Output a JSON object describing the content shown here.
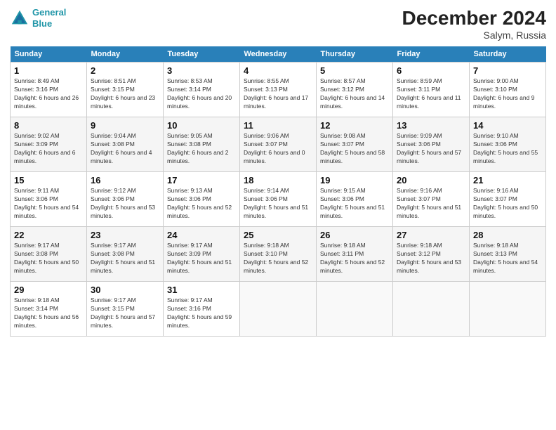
{
  "header": {
    "logo_line1": "General",
    "logo_line2": "Blue",
    "title": "December 2024",
    "subtitle": "Salym, Russia"
  },
  "days_of_week": [
    "Sunday",
    "Monday",
    "Tuesday",
    "Wednesday",
    "Thursday",
    "Friday",
    "Saturday"
  ],
  "weeks": [
    [
      {
        "num": "1",
        "sunrise": "Sunrise: 8:49 AM",
        "sunset": "Sunset: 3:16 PM",
        "daylight": "Daylight: 6 hours and 26 minutes."
      },
      {
        "num": "2",
        "sunrise": "Sunrise: 8:51 AM",
        "sunset": "Sunset: 3:15 PM",
        "daylight": "Daylight: 6 hours and 23 minutes."
      },
      {
        "num": "3",
        "sunrise": "Sunrise: 8:53 AM",
        "sunset": "Sunset: 3:14 PM",
        "daylight": "Daylight: 6 hours and 20 minutes."
      },
      {
        "num": "4",
        "sunrise": "Sunrise: 8:55 AM",
        "sunset": "Sunset: 3:13 PM",
        "daylight": "Daylight: 6 hours and 17 minutes."
      },
      {
        "num": "5",
        "sunrise": "Sunrise: 8:57 AM",
        "sunset": "Sunset: 3:12 PM",
        "daylight": "Daylight: 6 hours and 14 minutes."
      },
      {
        "num": "6",
        "sunrise": "Sunrise: 8:59 AM",
        "sunset": "Sunset: 3:11 PM",
        "daylight": "Daylight: 6 hours and 11 minutes."
      },
      {
        "num": "7",
        "sunrise": "Sunrise: 9:00 AM",
        "sunset": "Sunset: 3:10 PM",
        "daylight": "Daylight: 6 hours and 9 minutes."
      }
    ],
    [
      {
        "num": "8",
        "sunrise": "Sunrise: 9:02 AM",
        "sunset": "Sunset: 3:09 PM",
        "daylight": "Daylight: 6 hours and 6 minutes."
      },
      {
        "num": "9",
        "sunrise": "Sunrise: 9:04 AM",
        "sunset": "Sunset: 3:08 PM",
        "daylight": "Daylight: 6 hours and 4 minutes."
      },
      {
        "num": "10",
        "sunrise": "Sunrise: 9:05 AM",
        "sunset": "Sunset: 3:08 PM",
        "daylight": "Daylight: 6 hours and 2 minutes."
      },
      {
        "num": "11",
        "sunrise": "Sunrise: 9:06 AM",
        "sunset": "Sunset: 3:07 PM",
        "daylight": "Daylight: 6 hours and 0 minutes."
      },
      {
        "num": "12",
        "sunrise": "Sunrise: 9:08 AM",
        "sunset": "Sunset: 3:07 PM",
        "daylight": "Daylight: 5 hours and 58 minutes."
      },
      {
        "num": "13",
        "sunrise": "Sunrise: 9:09 AM",
        "sunset": "Sunset: 3:06 PM",
        "daylight": "Daylight: 5 hours and 57 minutes."
      },
      {
        "num": "14",
        "sunrise": "Sunrise: 9:10 AM",
        "sunset": "Sunset: 3:06 PM",
        "daylight": "Daylight: 5 hours and 55 minutes."
      }
    ],
    [
      {
        "num": "15",
        "sunrise": "Sunrise: 9:11 AM",
        "sunset": "Sunset: 3:06 PM",
        "daylight": "Daylight: 5 hours and 54 minutes."
      },
      {
        "num": "16",
        "sunrise": "Sunrise: 9:12 AM",
        "sunset": "Sunset: 3:06 PM",
        "daylight": "Daylight: 5 hours and 53 minutes."
      },
      {
        "num": "17",
        "sunrise": "Sunrise: 9:13 AM",
        "sunset": "Sunset: 3:06 PM",
        "daylight": "Daylight: 5 hours and 52 minutes."
      },
      {
        "num": "18",
        "sunrise": "Sunrise: 9:14 AM",
        "sunset": "Sunset: 3:06 PM",
        "daylight": "Daylight: 5 hours and 51 minutes."
      },
      {
        "num": "19",
        "sunrise": "Sunrise: 9:15 AM",
        "sunset": "Sunset: 3:06 PM",
        "daylight": "Daylight: 5 hours and 51 minutes."
      },
      {
        "num": "20",
        "sunrise": "Sunrise: 9:16 AM",
        "sunset": "Sunset: 3:07 PM",
        "daylight": "Daylight: 5 hours and 51 minutes."
      },
      {
        "num": "21",
        "sunrise": "Sunrise: 9:16 AM",
        "sunset": "Sunset: 3:07 PM",
        "daylight": "Daylight: 5 hours and 50 minutes."
      }
    ],
    [
      {
        "num": "22",
        "sunrise": "Sunrise: 9:17 AM",
        "sunset": "Sunset: 3:08 PM",
        "daylight": "Daylight: 5 hours and 50 minutes."
      },
      {
        "num": "23",
        "sunrise": "Sunrise: 9:17 AM",
        "sunset": "Sunset: 3:08 PM",
        "daylight": "Daylight: 5 hours and 51 minutes."
      },
      {
        "num": "24",
        "sunrise": "Sunrise: 9:17 AM",
        "sunset": "Sunset: 3:09 PM",
        "daylight": "Daylight: 5 hours and 51 minutes."
      },
      {
        "num": "25",
        "sunrise": "Sunrise: 9:18 AM",
        "sunset": "Sunset: 3:10 PM",
        "daylight": "Daylight: 5 hours and 52 minutes."
      },
      {
        "num": "26",
        "sunrise": "Sunrise: 9:18 AM",
        "sunset": "Sunset: 3:11 PM",
        "daylight": "Daylight: 5 hours and 52 minutes."
      },
      {
        "num": "27",
        "sunrise": "Sunrise: 9:18 AM",
        "sunset": "Sunset: 3:12 PM",
        "daylight": "Daylight: 5 hours and 53 minutes."
      },
      {
        "num": "28",
        "sunrise": "Sunrise: 9:18 AM",
        "sunset": "Sunset: 3:13 PM",
        "daylight": "Daylight: 5 hours and 54 minutes."
      }
    ],
    [
      {
        "num": "29",
        "sunrise": "Sunrise: 9:18 AM",
        "sunset": "Sunset: 3:14 PM",
        "daylight": "Daylight: 5 hours and 56 minutes."
      },
      {
        "num": "30",
        "sunrise": "Sunrise: 9:17 AM",
        "sunset": "Sunset: 3:15 PM",
        "daylight": "Daylight: 5 hours and 57 minutes."
      },
      {
        "num": "31",
        "sunrise": "Sunrise: 9:17 AM",
        "sunset": "Sunset: 3:16 PM",
        "daylight": "Daylight: 5 hours and 59 minutes."
      },
      null,
      null,
      null,
      null
    ]
  ]
}
